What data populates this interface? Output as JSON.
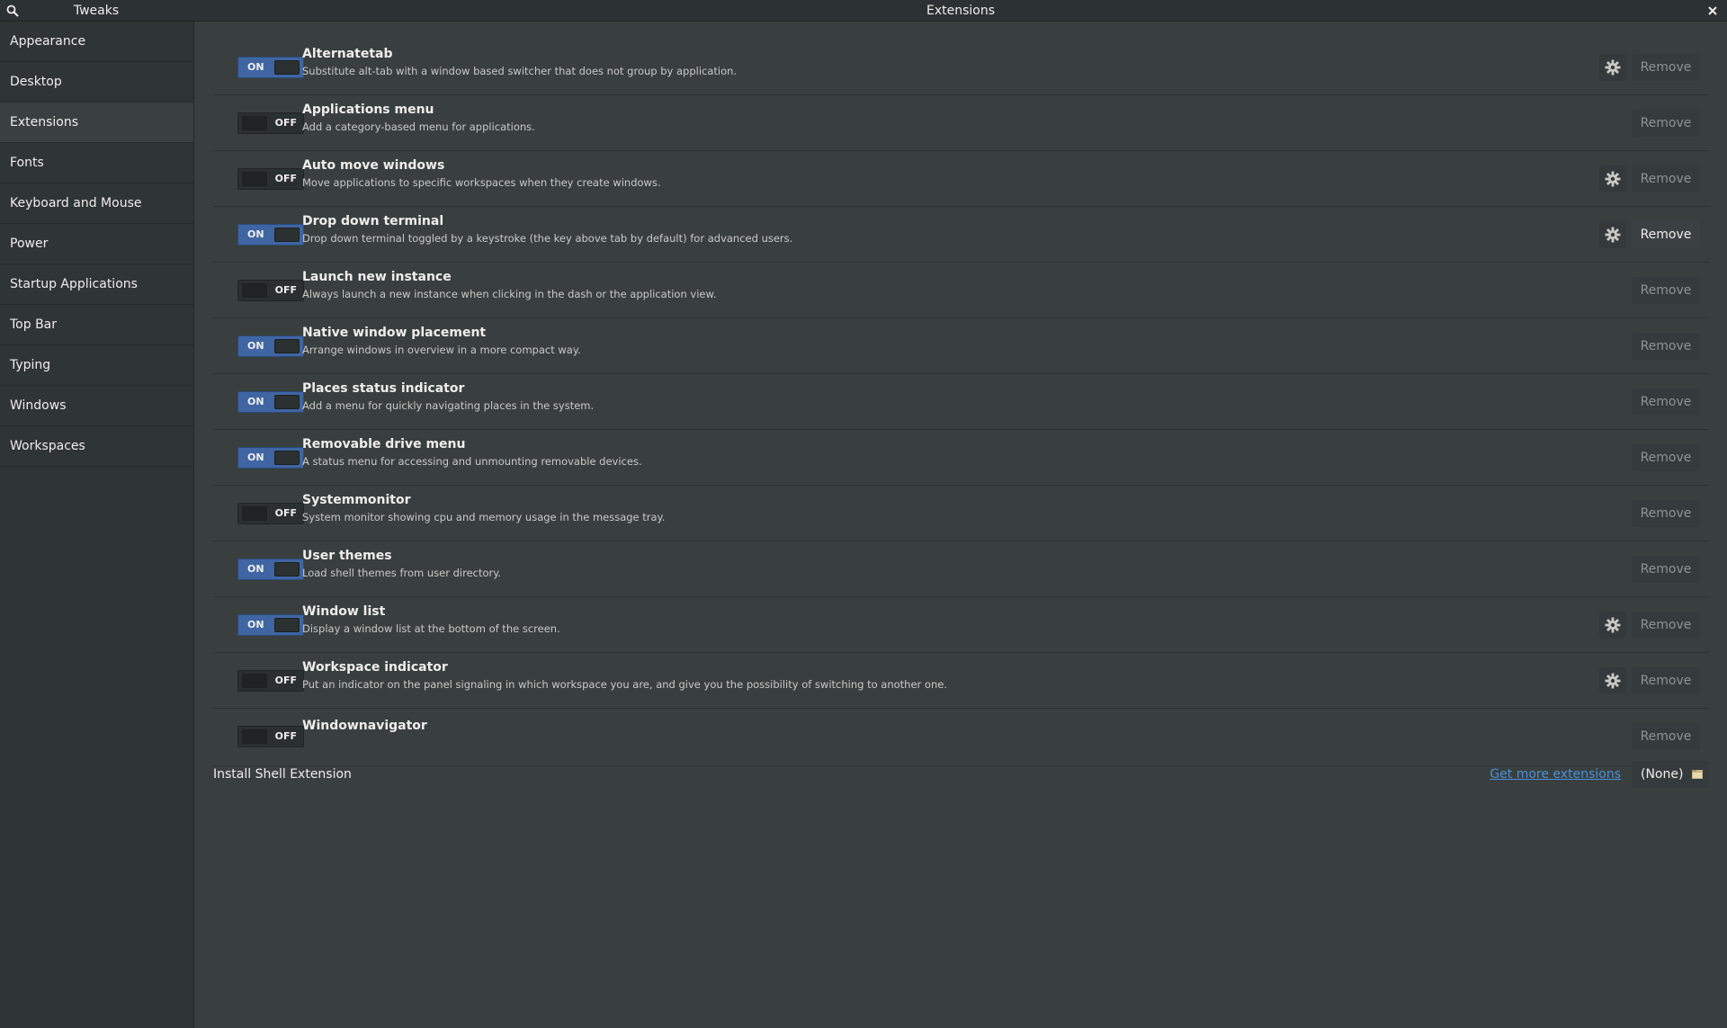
{
  "window": {
    "sidebar_title": "Tweaks",
    "main_title": "Extensions"
  },
  "sidebar": {
    "items": [
      {
        "label": "Appearance",
        "active": false
      },
      {
        "label": "Desktop",
        "active": false
      },
      {
        "label": "Extensions",
        "active": true
      },
      {
        "label": "Fonts",
        "active": false
      },
      {
        "label": "Keyboard and Mouse",
        "active": false
      },
      {
        "label": "Power",
        "active": false
      },
      {
        "label": "Startup Applications",
        "active": false
      },
      {
        "label": "Top Bar",
        "active": false
      },
      {
        "label": "Typing",
        "active": false
      },
      {
        "label": "Windows",
        "active": false
      },
      {
        "label": "Workspaces",
        "active": false
      }
    ]
  },
  "toggle_labels": {
    "on": "ON",
    "off": "OFF"
  },
  "remove_label": "Remove",
  "extensions": [
    {
      "name": "Alternatetab",
      "desc": "Substitute alt-tab with a window based switcher that does not group by application.",
      "enabled": true,
      "settings": true
    },
    {
      "name": "Applications menu",
      "desc": "Add a category-based menu for applications.",
      "enabled": false,
      "settings": false
    },
    {
      "name": "Auto move windows",
      "desc": "Move applications to specific workspaces when they create windows.",
      "enabled": false,
      "settings": true
    },
    {
      "name": "Drop down terminal",
      "desc": "Drop down terminal toggled by a keystroke (the key above tab by default) for advanced users.",
      "enabled": true,
      "settings": true
    },
    {
      "name": "Launch new instance",
      "desc": "Always launch a new instance when clicking in the dash or the application view.",
      "enabled": false,
      "settings": false
    },
    {
      "name": "Native window placement",
      "desc": "Arrange windows in overview in a more compact way.",
      "enabled": true,
      "settings": false
    },
    {
      "name": "Places status indicator",
      "desc": "Add a menu for quickly navigating places in the system.",
      "enabled": true,
      "settings": false
    },
    {
      "name": "Removable drive menu",
      "desc": "A status menu for accessing and unmounting removable devices.",
      "enabled": true,
      "settings": false
    },
    {
      "name": "Systemmonitor",
      "desc": "System monitor showing cpu and memory usage in the message tray.",
      "enabled": false,
      "settings": false
    },
    {
      "name": "User themes",
      "desc": "Load shell themes from user directory.",
      "enabled": true,
      "settings": false
    },
    {
      "name": "Window list",
      "desc": "Display a window list at the bottom of the screen.",
      "enabled": true,
      "settings": true
    },
    {
      "name": "Workspace indicator",
      "desc": "Put an indicator on the panel signaling in which workspace you are, and give you the possibility of switching to another one.",
      "enabled": false,
      "settings": true
    },
    {
      "name": "Windownavigator",
      "desc": "",
      "enabled": false,
      "settings": false
    }
  ],
  "install": {
    "label": "Install Shell Extension",
    "more_link": "Get more extensions",
    "file_value": "(None)"
  }
}
